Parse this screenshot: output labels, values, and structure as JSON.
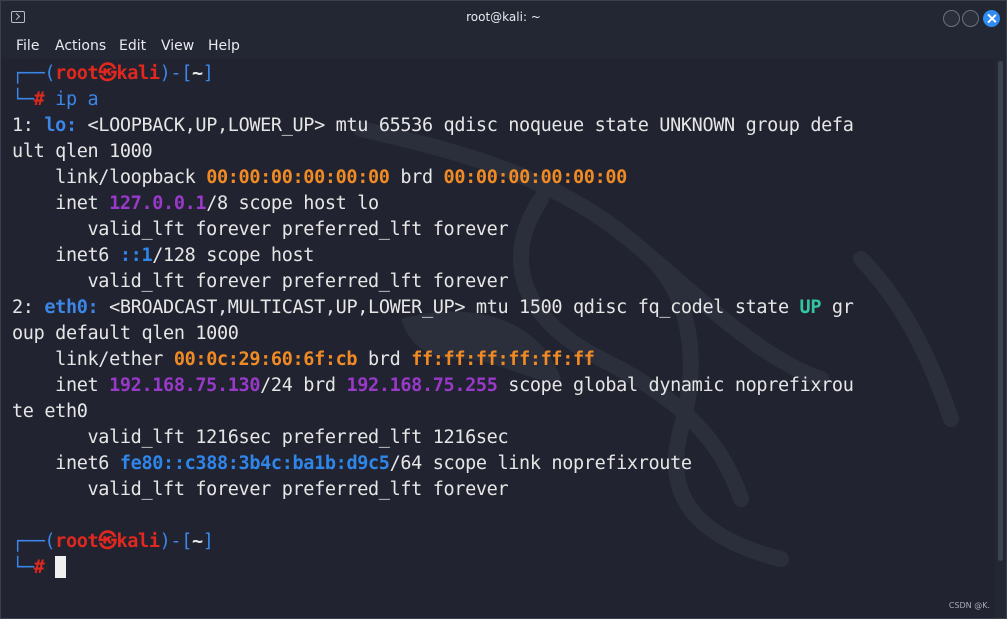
{
  "window": {
    "title": "root@kali: ~"
  },
  "menu": [
    "File",
    "Actions",
    "Edit",
    "View",
    "Help"
  ],
  "prompt": {
    "open": "┌──(",
    "user": "root",
    "at": "㉿",
    "host": "kali",
    "mid": ")-[",
    "dir": "~",
    "close": "]",
    "corner": "└─",
    "hash": "#"
  },
  "command": "ip a",
  "output": {
    "l1": {
      "num": "1: ",
      "iface": "lo:",
      "rest": " <LOOPBACK,UP,LOWER_UP> mtu 65536 qdisc noqueue state UNKNOWN group defa"
    },
    "l2": "ult qlen 1000",
    "l3": {
      "pre": "    link/loopback ",
      "mac": "00:00:00:00:00:00",
      "mid": " brd ",
      "brd": "00:00:00:00:00:00"
    },
    "l4": {
      "pre": "    inet ",
      "ip": "127.0.0.1",
      "rest": "/8 scope host lo"
    },
    "l5": "       valid_lft forever preferred_lft forever",
    "l6": {
      "pre": "    inet6 ",
      "ip": "::1",
      "rest": "/128 scope host"
    },
    "l7": "       valid_lft forever preferred_lft forever",
    "l8": {
      "num": "2: ",
      "iface": "eth0:",
      "rest": " <BROADCAST,MULTICAST,UP,LOWER_UP> mtu 1500 qdisc fq_codel state ",
      "state": "UP",
      "tail": " gr"
    },
    "l9": "oup default qlen 1000",
    "l10": {
      "pre": "    link/ether ",
      "mac": "00:0c:29:60:6f:cb",
      "mid": " brd ",
      "brd": "ff:ff:ff:ff:ff:ff"
    },
    "l11": {
      "pre": "    inet ",
      "ip": "192.168.75.130",
      "mid": "/24 brd ",
      "brd": "192.168.75.255",
      "rest": " scope global dynamic noprefixrou"
    },
    "l12": "te eth0",
    "l13": "       valid_lft 1216sec preferred_lft 1216sec",
    "l14": {
      "pre": "    inet6 ",
      "ip": "fe80::c388:3b4c:ba1b:d9c5",
      "rest": "/64 scope link noprefixroute"
    },
    "l15": "       valid_lft forever preferred_lft forever"
  },
  "watermark": "CSDN @K.",
  "colors": {
    "prompt_red": "#e2281e",
    "prompt_blue": "#3c86e8",
    "mac_orange": "#f08a24",
    "ip_purple": "#9939c9",
    "state_green": "#34c6a4"
  }
}
